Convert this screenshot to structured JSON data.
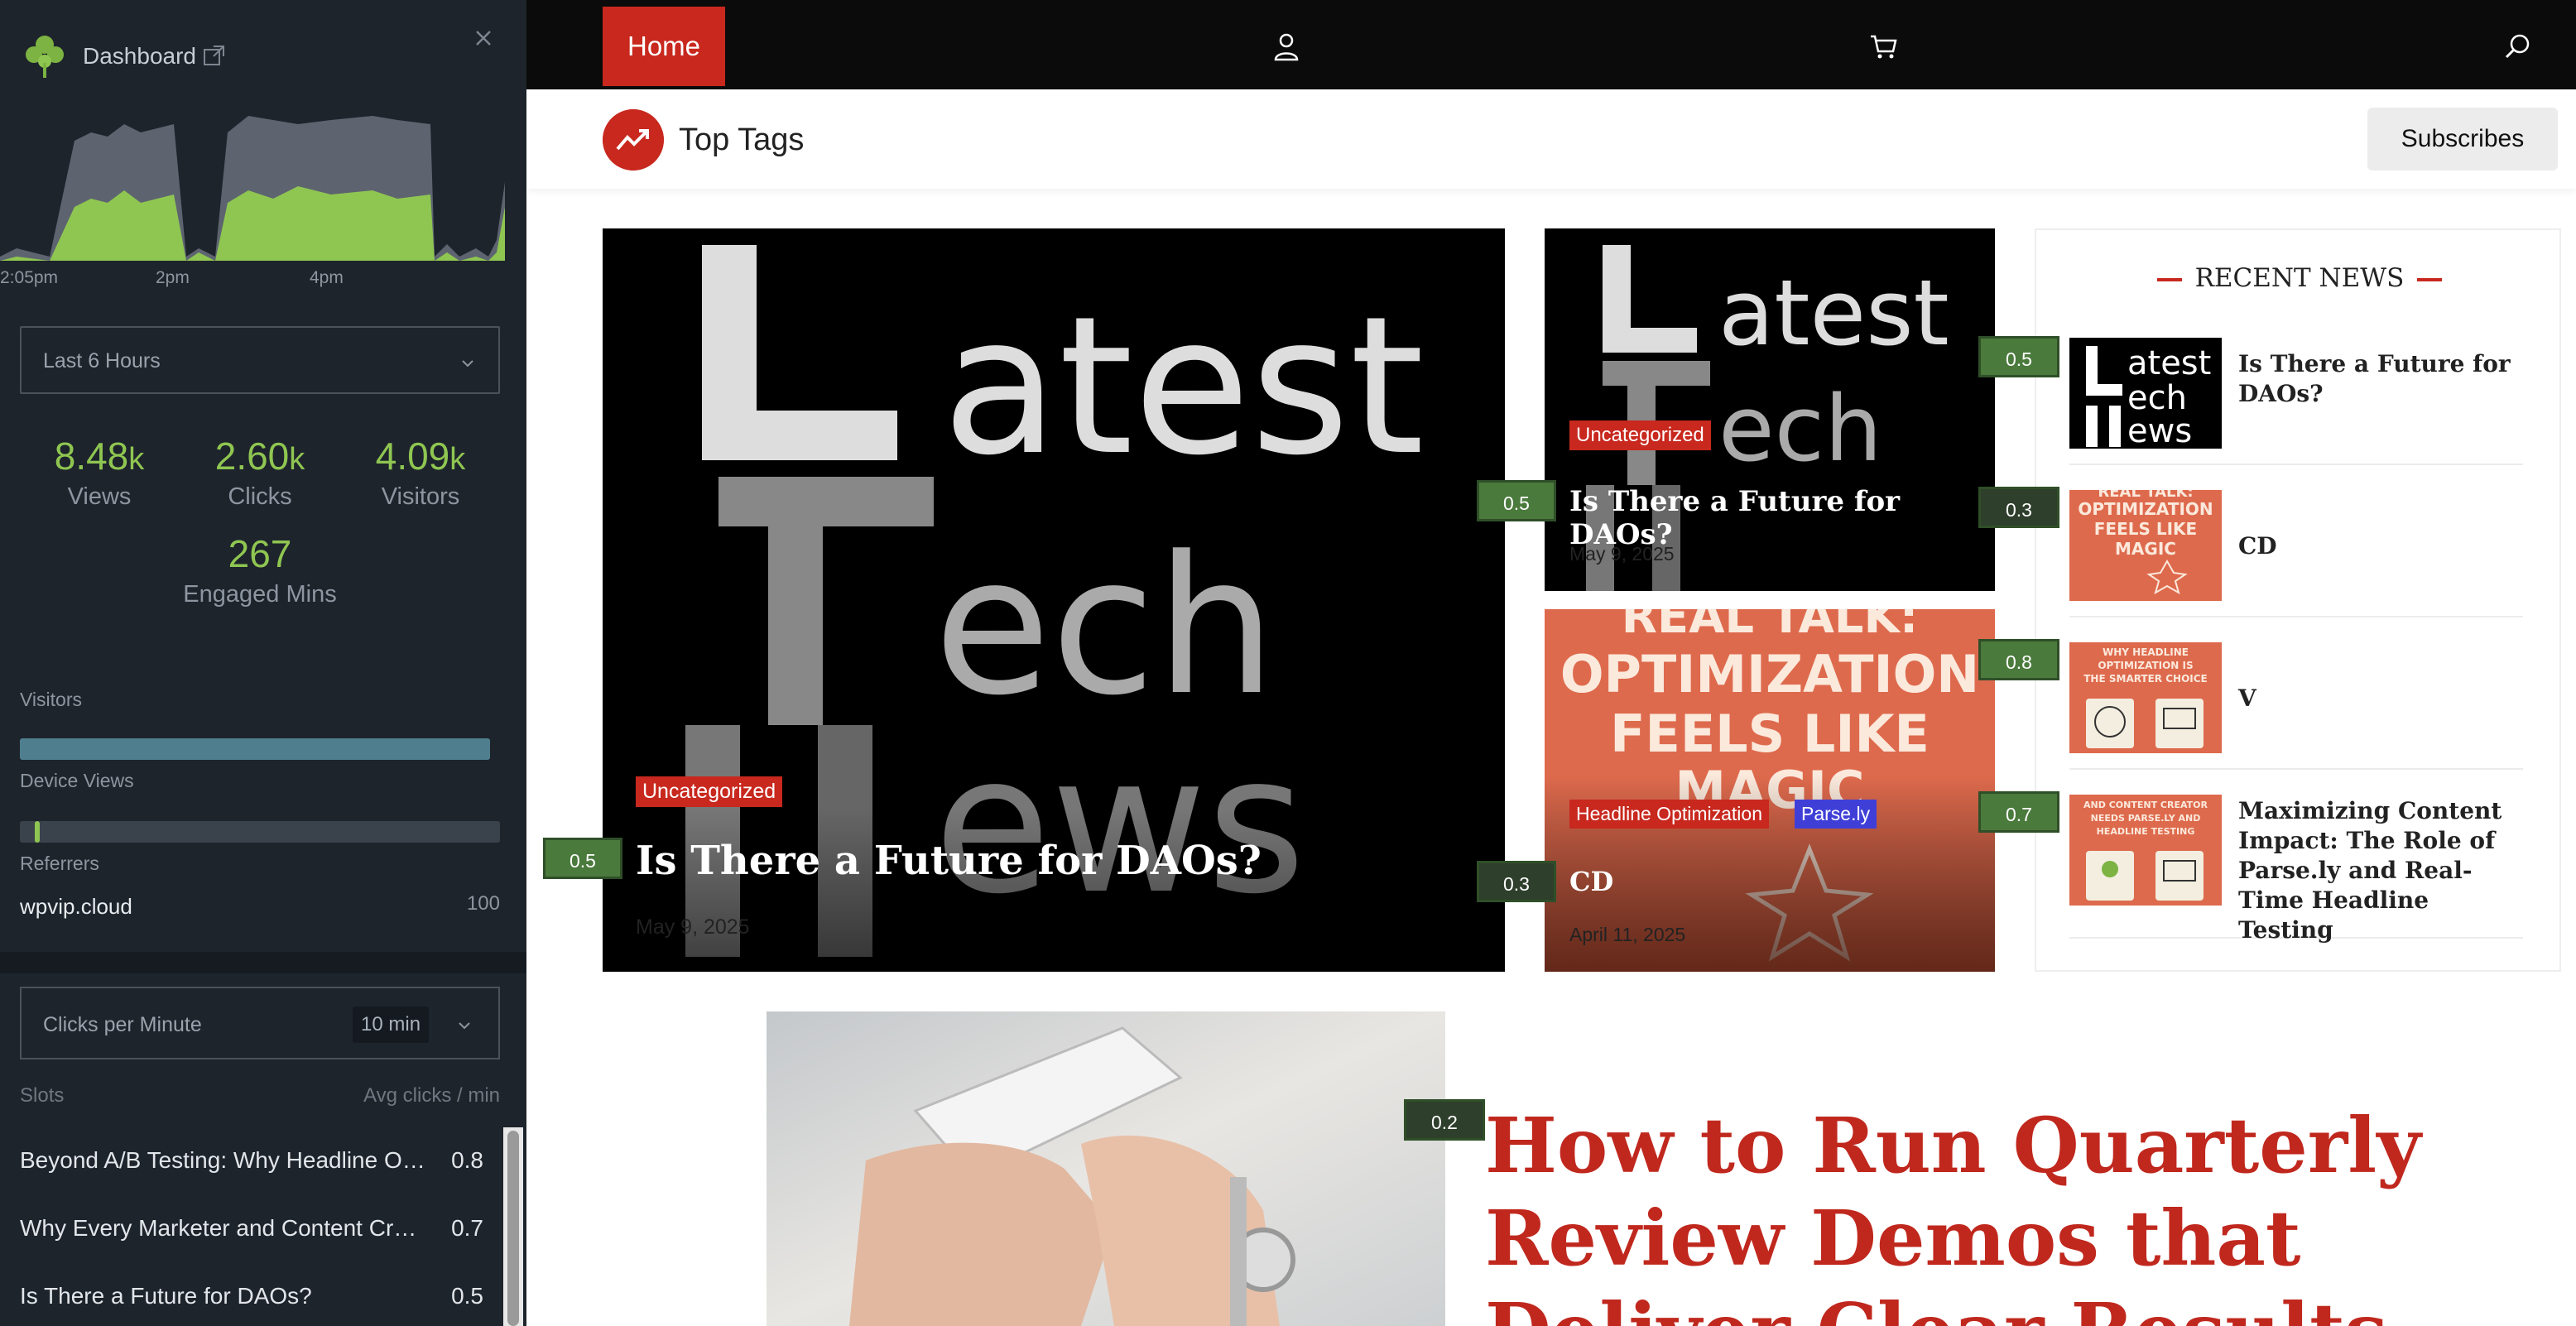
{
  "sidebar": {
    "title": "Dashboard",
    "chart_times": [
      "2:05pm",
      "2pm",
      "4pm"
    ],
    "timeframe": "Last 6 Hours",
    "kpis": [
      {
        "value": "8.48",
        "unit": "k",
        "label": "Views"
      },
      {
        "value": "2.60",
        "unit": "k",
        "label": "Clicks"
      },
      {
        "value": "4.09",
        "unit": "k",
        "label": "Visitors"
      },
      {
        "value": "267",
        "unit": "",
        "label": "Engaged Mins"
      }
    ],
    "visitors_label": "Visitors",
    "device_views_label": "Device Views",
    "referrers_label": "Referrers",
    "referrer": {
      "name": "wpvip.cloud",
      "value": "100"
    },
    "cpm_label": "Clicks per Minute",
    "cpm_window": "10 min",
    "slots_label": "Slots",
    "avg_label": "Avg clicks / min",
    "slots": [
      {
        "title": "Beyond A/B Testing: Why Headline Optimization Is the Smarter Choice",
        "value": "0.8"
      },
      {
        "title": "Why Every Marketer and Content Creator Needs Parse.ly and Headline Testing",
        "value": "0.7"
      },
      {
        "title": "Is There a Future for DAOs?",
        "value": "0.5"
      }
    ],
    "colors": {
      "bg": "#1e242c",
      "accent": "#8fc651"
    }
  },
  "nav": {
    "home": "Home",
    "icons": [
      "user-icon",
      "cart-icon",
      "search-icon"
    ]
  },
  "tagbar": {
    "title": "Top Tags",
    "subscribe": "Subscribes"
  },
  "posts": {
    "main": {
      "category": "Uncategorized",
      "title": "Is There a Future for DAOs?",
      "date": "May 9, 2025",
      "score": "0.5",
      "image_text": [
        "atest",
        "ech",
        "ews"
      ]
    },
    "top_right": {
      "category": "Uncategorized",
      "title": "Is There a Future for DAOs?",
      "date": "May 9, 2025",
      "score": "0.5",
      "image_text": [
        "atest",
        "ech",
        "ews"
      ]
    },
    "bottom_right": {
      "categories": [
        "Headline Optimization",
        "Parse.ly"
      ],
      "title": "CD",
      "date": "April 11, 2025",
      "score": "0.3",
      "image_text": [
        "REAL TALK:",
        "OPTIMIZATION",
        "FEELS LIKE",
        "MAGIC"
      ]
    }
  },
  "recent": {
    "title": "RECENT NEWS",
    "items": [
      {
        "title": "Is There a Future for DAOs?",
        "score": "0.5"
      },
      {
        "title": "CD",
        "score": "0.3",
        "thumb_text": [
          "REAL TALK:",
          "OPTIMIZATION",
          "FEELS LIKE",
          "MAGIC"
        ]
      },
      {
        "title": "V",
        "score": "0.8",
        "thumb_text": [
          "WHY HEADLINE",
          "OPTIMIZATION IS",
          "THE SMARTER CHOICE"
        ]
      },
      {
        "title": "Maximizing Content Impact: The Role of Parse.ly and Real-Time Headline Testing",
        "score": "0.7",
        "thumb_text": [
          "AND CONTENT CREATOR",
          "NEEDS PARSE.LY AND",
          "HEADLINE TESTING"
        ]
      }
    ]
  },
  "featured": {
    "title": "How to Run Quarterly Review Demos that Deliver Clear Results",
    "score": "0.2"
  }
}
